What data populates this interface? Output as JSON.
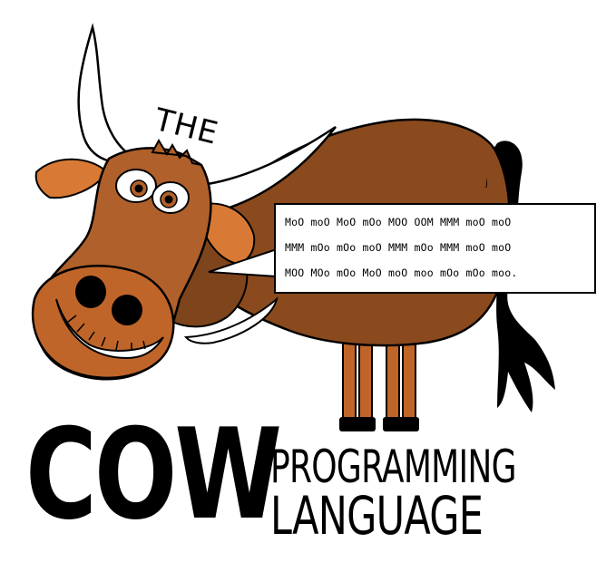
{
  "logo": {
    "top_label": "THE",
    "speech_lines": [
      "MoO moO MoO mOo MOO OOM MMM moO moO",
      "MMM mOo mOo moO MMM mOo MMM moO moO",
      "MOO MOo mOo MoO moO moo mOo mOo moo."
    ],
    "title_big": "COW",
    "title_line1": "PROGRAMMING",
    "title_line2": "LANGUAGE",
    "signature": "j"
  },
  "colors": {
    "cow_body": "#8a4a1e",
    "cow_head": "#b0602a",
    "cow_ear": "#d87a35",
    "horn": "#ffffff",
    "outline": "#000000"
  }
}
